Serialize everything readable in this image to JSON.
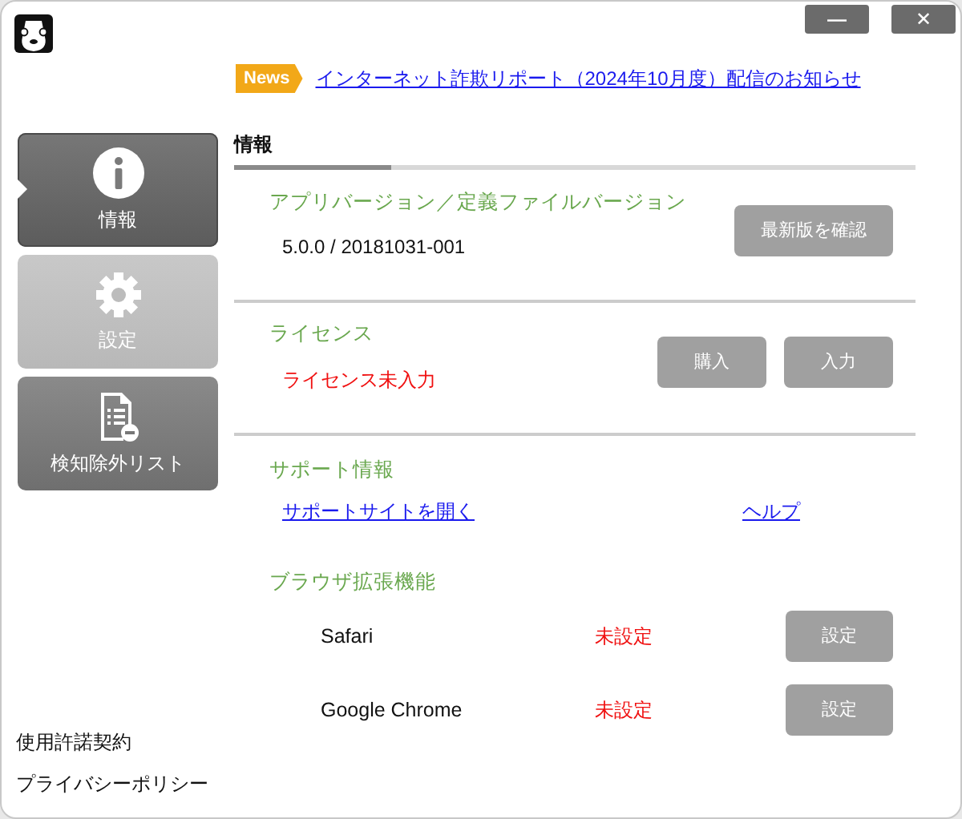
{
  "window": {
    "buttons": [
      {
        "kind": "minimize",
        "label": "—"
      },
      {
        "kind": "close",
        "label": "✕"
      }
    ]
  },
  "news": {
    "badge": "News",
    "link": "インターネット詐欺リポート（2024年10月度）配信のお知らせ"
  },
  "sidebar": {
    "items": [
      {
        "label": "情報",
        "kind": "info",
        "selected": true,
        "hovered": false
      },
      {
        "label": "設定",
        "kind": "gear",
        "selected": false,
        "hovered": true
      },
      {
        "label": "検知除外リスト",
        "kind": "list",
        "selected": false,
        "hovered": false
      }
    ],
    "links": [
      "使用許諾契約",
      "プライバシーポリシー"
    ]
  },
  "tab": {
    "title": "情報",
    "level": 0.23
  },
  "version": {
    "title": "アプリバージョン／定義ファイルバージョン",
    "value": "5.0.0 / 20181031-001",
    "button": "最新版を確認"
  },
  "license": {
    "title": "ライセンス",
    "status": "ライセンス未入力",
    "buttons": [
      "購入",
      "入力"
    ]
  },
  "support": {
    "title": "サポート情報",
    "links": [
      "サポートサイトを開く",
      "ヘルプ"
    ]
  },
  "extensions": {
    "title": "ブラウザ拡張機能",
    "rows": [
      {
        "browser": "Safari",
        "status": "未設定",
        "button": "設定"
      },
      {
        "browser": "Google Chrome",
        "status": "未設定",
        "button": "設定"
      }
    ]
  }
}
